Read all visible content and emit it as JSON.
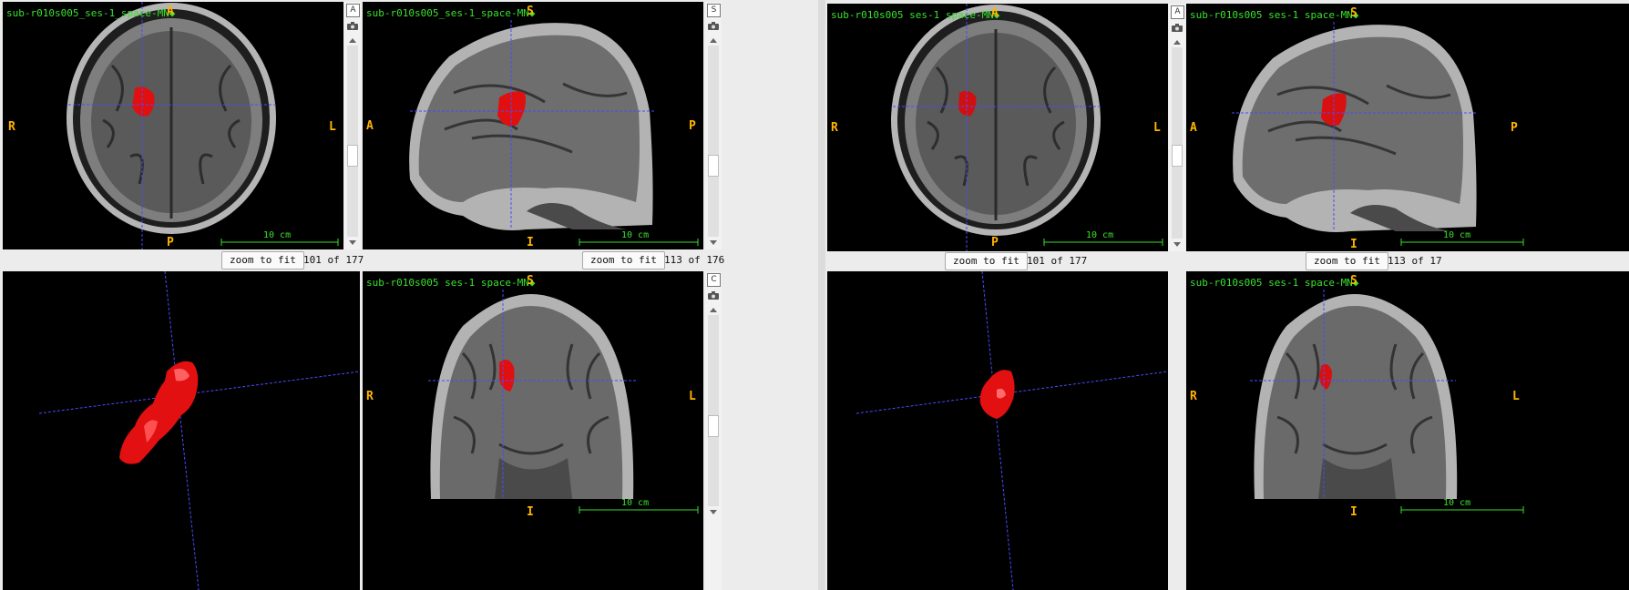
{
  "viewers": [
    {
      "axial": {
        "filename": "sub-r010s005_ses-1_space-MN◆",
        "orient": {
          "top": "A",
          "bottom": "P",
          "left": "R",
          "right": "L"
        },
        "scale": "10 cm",
        "slice": "101 of 177"
      },
      "sagittal": {
        "filename": "sub-r010s005_ses-1_space-MN◆",
        "orient": {
          "top": "S",
          "bottom": "I",
          "left": "A",
          "right": "P"
        },
        "scale": "10 cm",
        "slice": "113 of 176"
      },
      "coronal": {
        "filename": "sub-r010s005 ses-1 space-MN◆",
        "orient": {
          "top": "S",
          "bottom": "I",
          "left": "R",
          "right": "L"
        },
        "scale": "10 cm"
      },
      "sidebar_buttons": [
        "A",
        "S",
        "C"
      ]
    },
    {
      "axial": {
        "filename": "sub-r010s005 ses-1 space-MN◆",
        "orient": {
          "top": "A",
          "bottom": "P",
          "left": "R",
          "right": "L"
        },
        "scale": "10 cm",
        "slice": "101 of 177"
      },
      "sagittal": {
        "filename": "sub-r010s005 ses-1 space-MN◆",
        "orient": {
          "top": "S",
          "bottom": "I",
          "left": "A",
          "right": "P"
        },
        "scale": "10 cm",
        "slice": "113 of 17"
      },
      "coronal": {
        "filename": "sub-r010s005 ses-1 space-MN◆",
        "orient": {
          "top": "S",
          "bottom": "I",
          "left": "R",
          "right": "L"
        },
        "scale": "10 cm"
      },
      "sidebar_buttons": [
        "A"
      ]
    }
  ],
  "zoom_button_label": "zoom to fit",
  "colors": {
    "orientation": "#ffb400",
    "filename": "#39e12d",
    "crosshair": "#4b4bff",
    "lesion": "#ff1010"
  }
}
